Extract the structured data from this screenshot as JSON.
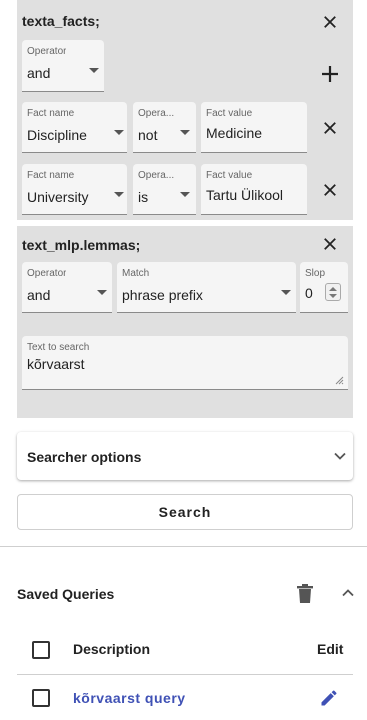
{
  "panel1": {
    "title": "texta_facts;",
    "operator": {
      "label": "Operator",
      "value": "and"
    },
    "rows": [
      {
        "fact_name_label": "Fact name",
        "fact_name": "Discipline",
        "operator_label": "Opera...",
        "operator": "not",
        "fact_value_label": "Fact value",
        "fact_value": "Medicine"
      },
      {
        "fact_name_label": "Fact name",
        "fact_name": "University",
        "operator_label": "Opera...",
        "operator": "is",
        "fact_value_label": "Fact value",
        "fact_value": "Tartu Ülikool"
      }
    ]
  },
  "panel2": {
    "title": "text_mlp.lemmas;",
    "operator": {
      "label": "Operator",
      "value": "and"
    },
    "match": {
      "label": "Match",
      "value": "phrase prefix"
    },
    "slop": {
      "label": "Slop",
      "value": "0"
    },
    "text": {
      "label": "Text to search",
      "value": "kõrvaarst"
    }
  },
  "searcher_options": {
    "label": "Searcher options"
  },
  "search_button": {
    "label": "Search"
  },
  "saved_queries": {
    "title": "Saved Queries",
    "columns": {
      "description": "Description",
      "edit": "Edit"
    },
    "rows": [
      {
        "description": "kõrvaarst query"
      }
    ]
  },
  "colors": {
    "panel_bg": "#e0e0e0",
    "field_bg": "#f5f5f5",
    "link": "#3f51b5"
  },
  "icons": [
    "close-icon",
    "add-icon",
    "dropdown-arrow-icon",
    "chevron-down-icon",
    "chevron-up-icon",
    "delete-icon",
    "edit-icon"
  ]
}
